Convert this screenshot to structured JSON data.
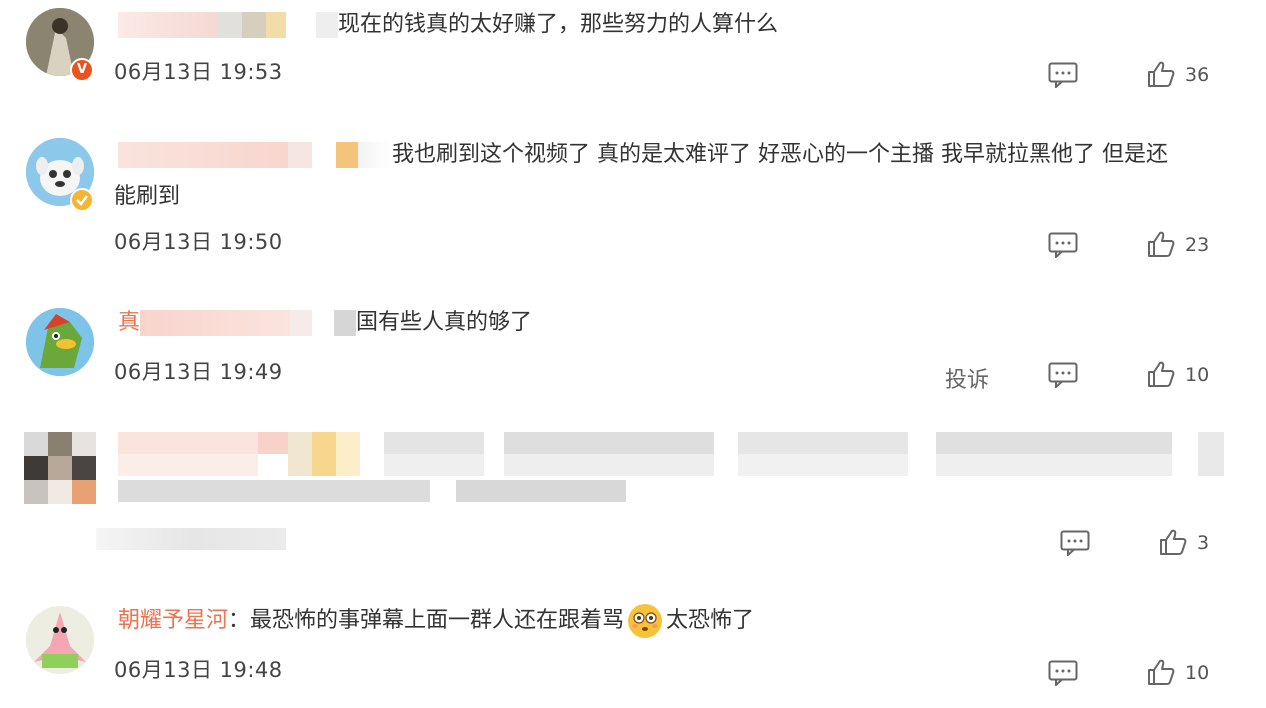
{
  "comments": [
    {
      "text": "现在的钱真的太好赚了，那些努力的人算什么",
      "time": "06月13日 19:53",
      "likes": "36",
      "badge": "V",
      "badge_color": "#e8541e"
    },
    {
      "text_line1": "我也刷到这个视频了 真的是太难评了 好恶心的一个主播 我早就拉黑他了 但是还",
      "text_line2": "能刷到",
      "time": "06月13日 19:50",
      "likes": "23",
      "badge_color": "#f2b634"
    },
    {
      "name_prefix": "真",
      "text": "国有些人真的够了",
      "time": "06月13日 19:49",
      "likes": "10",
      "report_label": "投诉"
    },
    {
      "likes": "3"
    },
    {
      "username": "朝耀予星河",
      "separator": "：",
      "text_before": "最恐怖的事弹幕上面一群人还在跟着骂",
      "text_after": "太恐怖了",
      "emoji": "flushed-face-emoji",
      "time": "06月13日 19:48",
      "likes": "10"
    }
  ],
  "colors": {
    "username": "#eb7350",
    "text": "#333333",
    "icon": "#666666"
  }
}
